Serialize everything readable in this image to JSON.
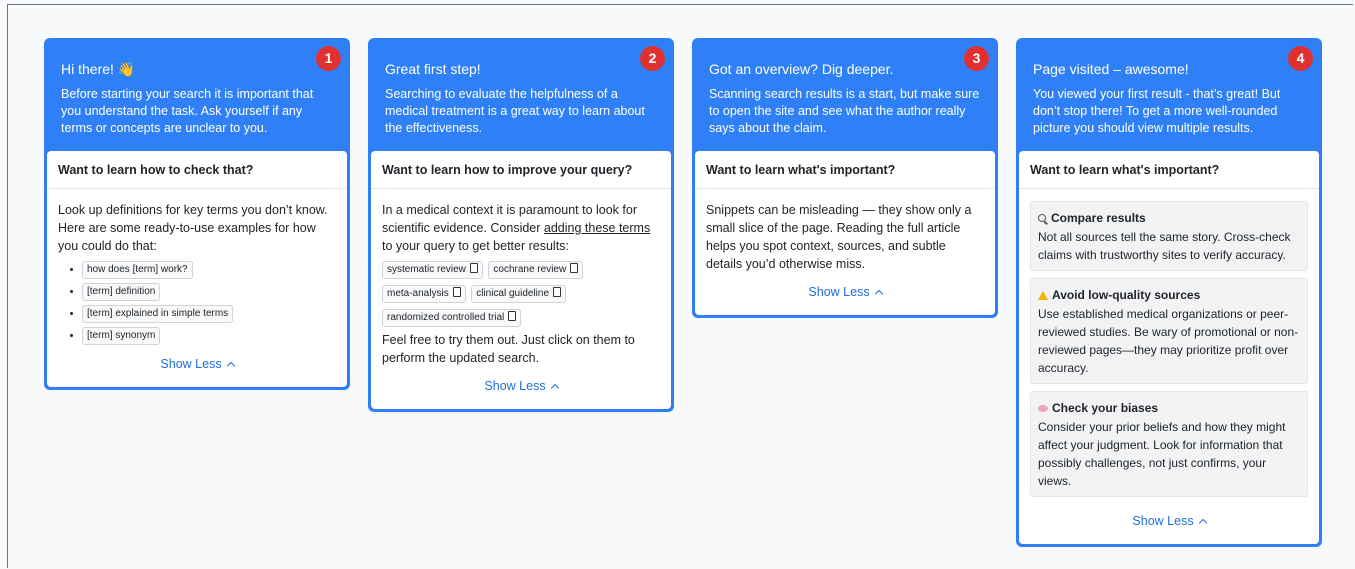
{
  "cards": [
    {
      "number": "1",
      "title": "Hi there! 👋",
      "intro": "Before starting your search it is important that you understand the task. Ask yourself if any terms or concepts are unclear to you.",
      "header": "Want to learn how to check that?",
      "text": "Look up definitions for key terms you don’t know. Here are some ready-to-use examples for how you could do that:",
      "examples": [
        "how does [term] work?",
        "[term] definition",
        "[term] explained in simple terms",
        "[term] synonym"
      ],
      "show_less": "Show Less"
    },
    {
      "number": "2",
      "title": "Great first step!",
      "intro": "Searching to evaluate the helpfulness of a medical treatment is a great way to learn about the effectiveness.",
      "header": "Want to learn how to improve your query?",
      "text_before": "In a medical context it is paramount to look for scientific evidence. Consider ",
      "text_link": "adding these terms",
      "text_after": " to your query to get better results:",
      "terms": [
        "systematic review",
        "cochrane review",
        "meta-analysis",
        "clinical guideline",
        "randomized controlled trial"
      ],
      "footer_text": "Feel free to try them out. Just click on them to perform the updated search.",
      "show_less": "Show Less"
    },
    {
      "number": "3",
      "title": "Got an overview? Dig deeper.",
      "intro": "Scanning search results is a start, but make sure to open the site and see what the author really says about the claim.",
      "header": "Want to learn what's important?",
      "text": "Snippets can be misleading — they show only a small slice of the page. Reading the full article helps you spot context, sources, and subtle details you’d otherwise miss.",
      "show_less": "Show Less"
    },
    {
      "number": "4",
      "title": "Page visited – awesome!",
      "intro": "You viewed your first result - that’s great! But don’t stop there! To get a more well-rounded picture you should view multiple results.",
      "header": "Want to learn what's important?",
      "tips": [
        {
          "icon": "magnifier-icon",
          "title": "Compare results",
          "text": "Not all sources tell the same story. Cross-check claims with trustworthy sites to verify accuracy."
        },
        {
          "icon": "warning-icon",
          "title": "Avoid low-quality sources",
          "text": "Use established medical organizations or peer-reviewed studies. Be wary of promotional or non-reviewed pages—they may prioritize profit over accuracy."
        },
        {
          "icon": "brain-icon",
          "title": "Check your biases",
          "text": "Consider your prior beliefs and how they might affect your judgment. Look for information that possibly challenges, not just confirms, your views."
        }
      ],
      "show_less": "Show Less"
    }
  ],
  "colors": {
    "card_blue": "#2f80f7",
    "badge_red": "#e03131",
    "link_blue": "#1d6fe0"
  }
}
